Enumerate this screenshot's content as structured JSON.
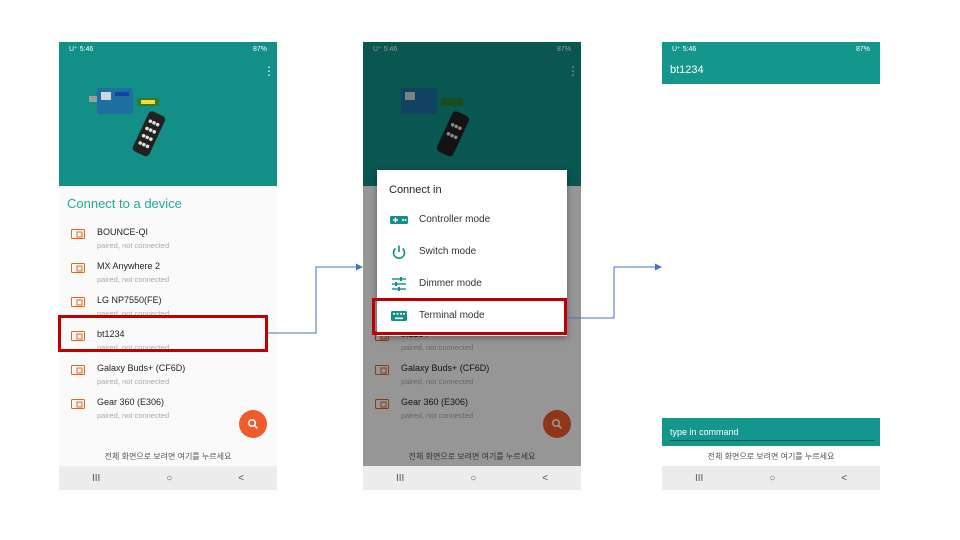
{
  "colors": {
    "teal": "#128f87",
    "accent_text": "#26a69a",
    "fab": "#ef5b2a",
    "highlight": "#c00000",
    "connector": "#4472c4"
  },
  "statusbar": {
    "left": "U⁺ 5:46",
    "right": "87%"
  },
  "screen1": {
    "section_title": "Connect to a device",
    "devices": [
      {
        "name": "BOUNCE-QI",
        "status": "paired, not connected"
      },
      {
        "name": "MX Anywhere 2",
        "status": "paired, not connected"
      },
      {
        "name": "LG NP7550(FE)",
        "status": "paired, not connected"
      },
      {
        "name": "bt1234",
        "status": "paired, not connected"
      },
      {
        "name": "Galaxy Buds+ (CF6D)",
        "status": "paired, not connected"
      },
      {
        "name": "Gear 360 (E306)",
        "status": "paired, not connected"
      }
    ],
    "hint": "전체 화면으로 보려면 여기를 누르세요",
    "fab_icon": "search-icon"
  },
  "screen2": {
    "dialog_title": "Connect in",
    "modes": [
      {
        "label": "Controller mode",
        "icon": "gamepad-icon"
      },
      {
        "label": "Switch mode",
        "icon": "power-icon"
      },
      {
        "label": "Dimmer mode",
        "icon": "sliders-icon"
      },
      {
        "label": "Terminal mode",
        "icon": "keyboard-icon"
      }
    ]
  },
  "screen3": {
    "title": "bt1234",
    "command_placeholder": "type in command"
  },
  "navbar": {
    "recent": "III",
    "home": "○",
    "back": "<"
  }
}
